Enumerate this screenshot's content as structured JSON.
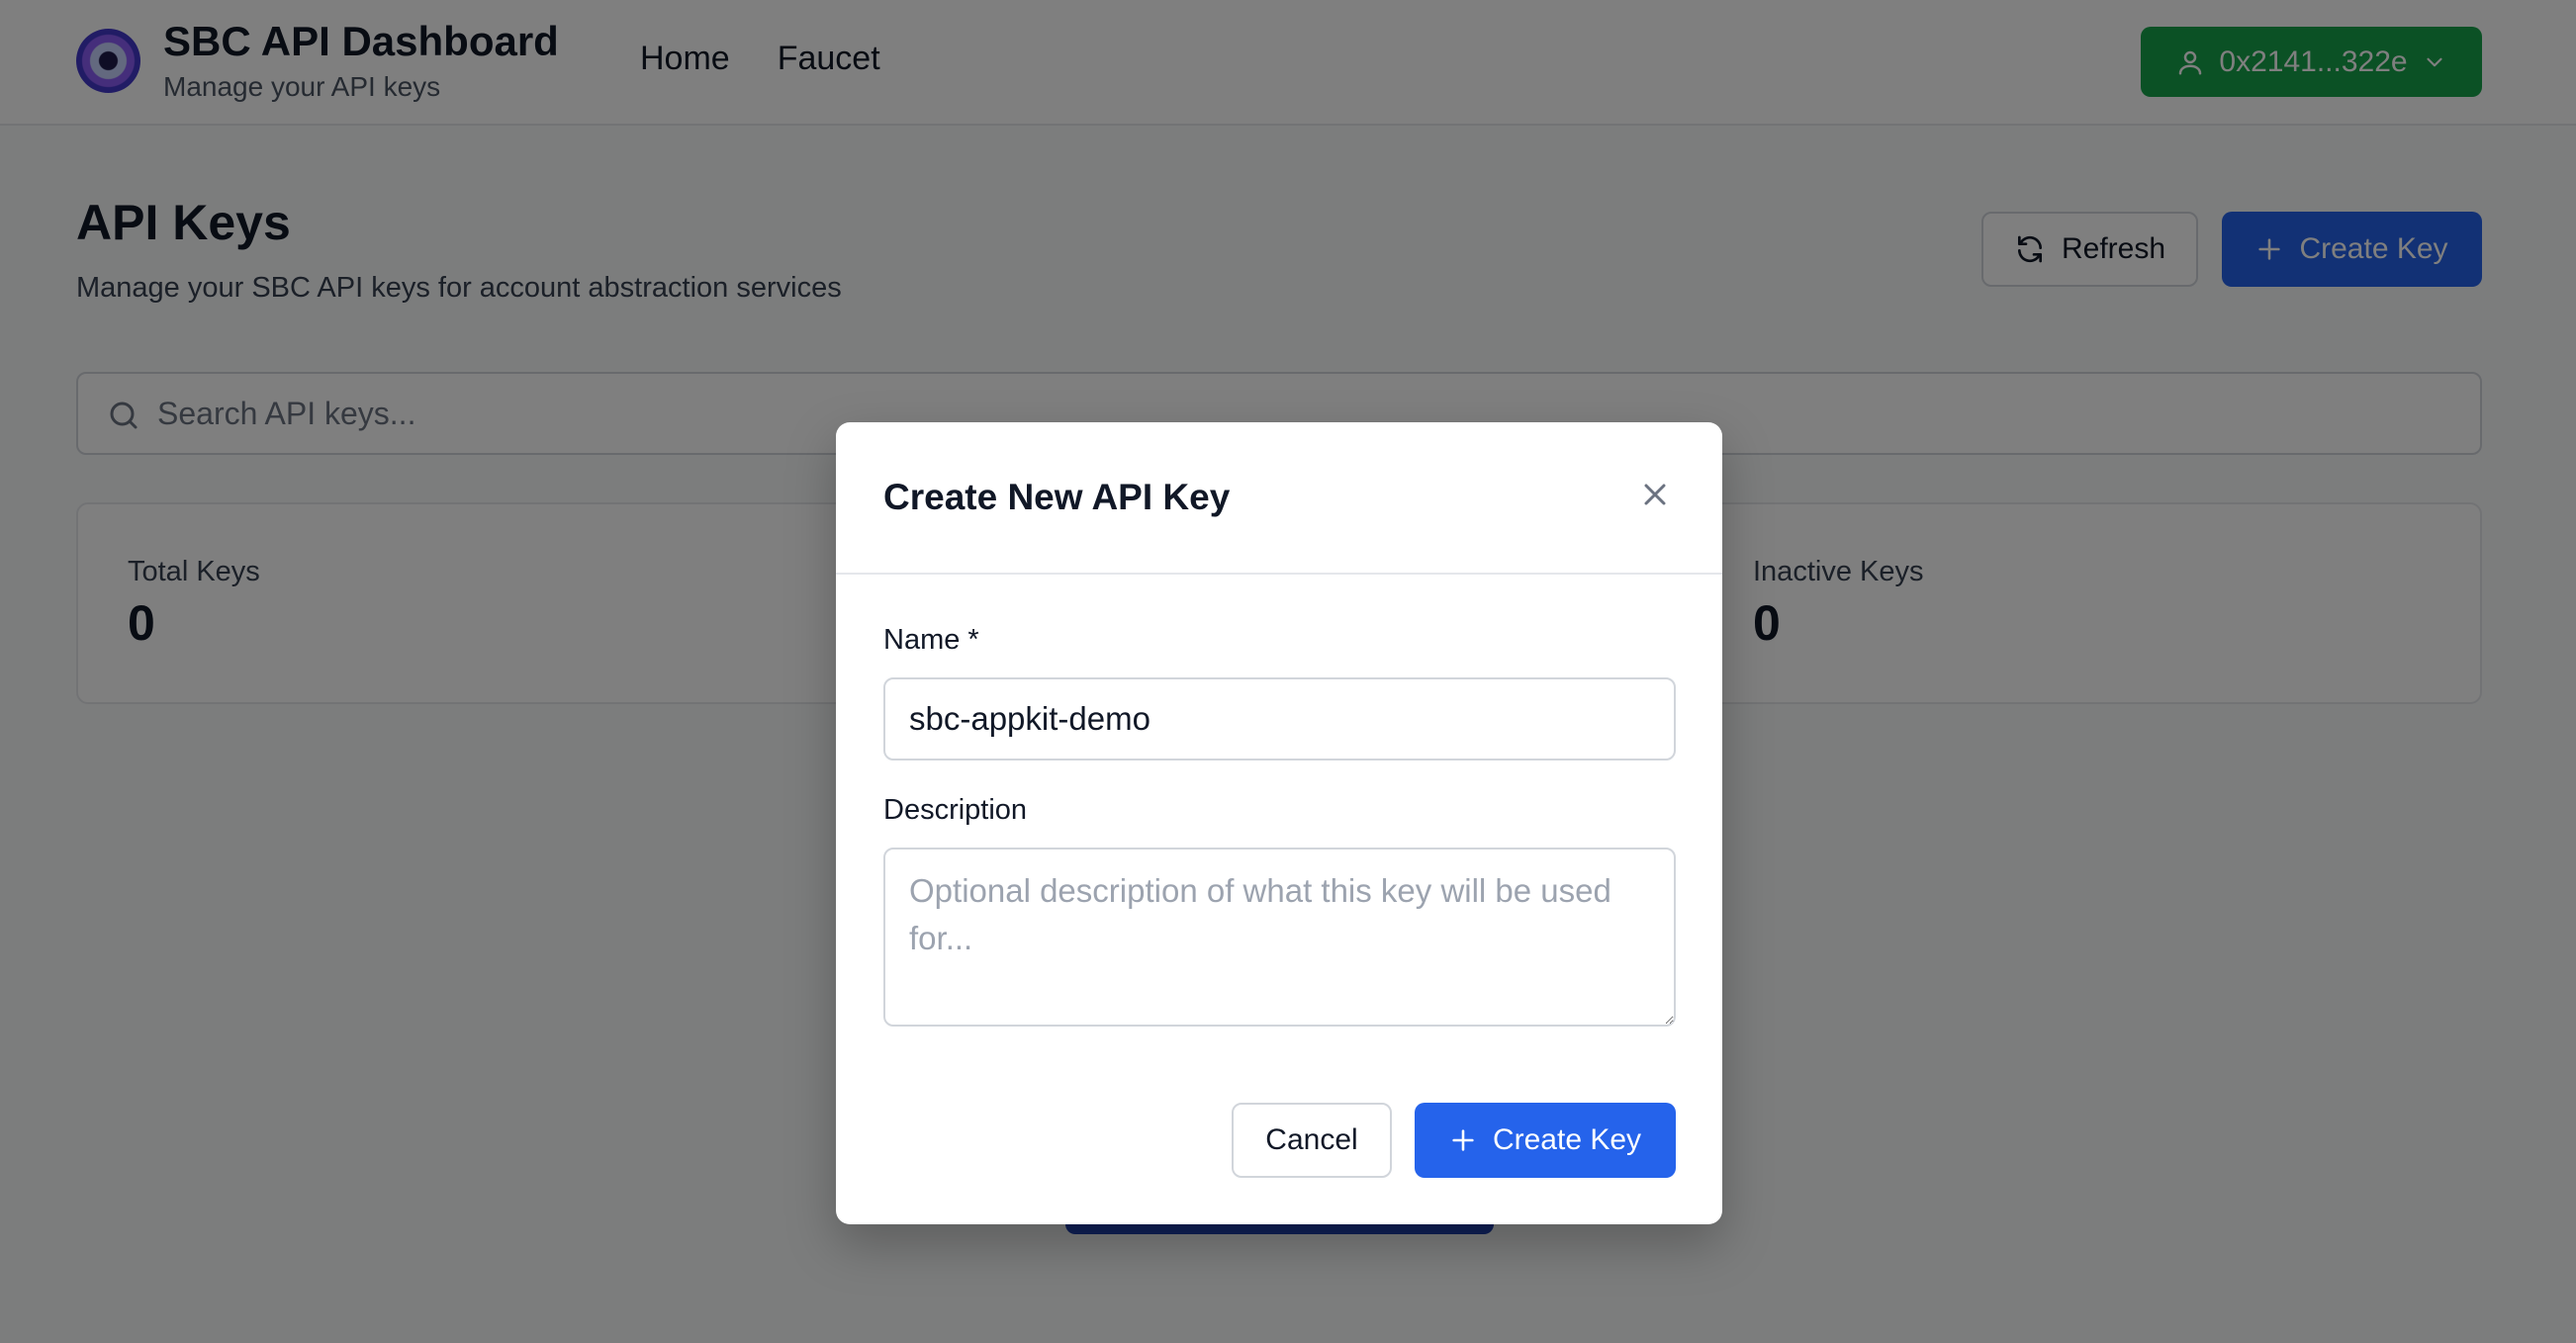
{
  "header": {
    "brand_title": "SBC API Dashboard",
    "brand_subtitle": "Manage your API keys",
    "nav": [
      "Home",
      "Faucet"
    ],
    "wallet_label": "0x2141...322e"
  },
  "main": {
    "title": "API Keys",
    "subtitle": "Manage your SBC API keys for account abstraction services",
    "refresh_label": "Refresh",
    "create_label": "Create Key",
    "search_placeholder": "Search API keys...",
    "stats": [
      {
        "label": "Total Keys",
        "value": "0"
      },
      {
        "label": "Inactive Keys",
        "value": "0"
      }
    ]
  },
  "modal": {
    "title": "Create New API Key",
    "name_label": "Name *",
    "name_value": "sbc-appkit-demo",
    "description_label": "Description",
    "description_placeholder": "Optional description of what this key will be used for...",
    "cancel_label": "Cancel",
    "create_label": "Create Key"
  },
  "colors": {
    "primary": "#2563eb",
    "wallet": "#16a34a",
    "overlay": "rgba(0,0,0,0.5)"
  },
  "icons": {
    "wallet_user": "user-icon",
    "wallet_chevron": "chevron-down-icon",
    "refresh": "refresh-icon",
    "plus": "plus-icon",
    "search": "search-icon",
    "close": "close-icon"
  }
}
